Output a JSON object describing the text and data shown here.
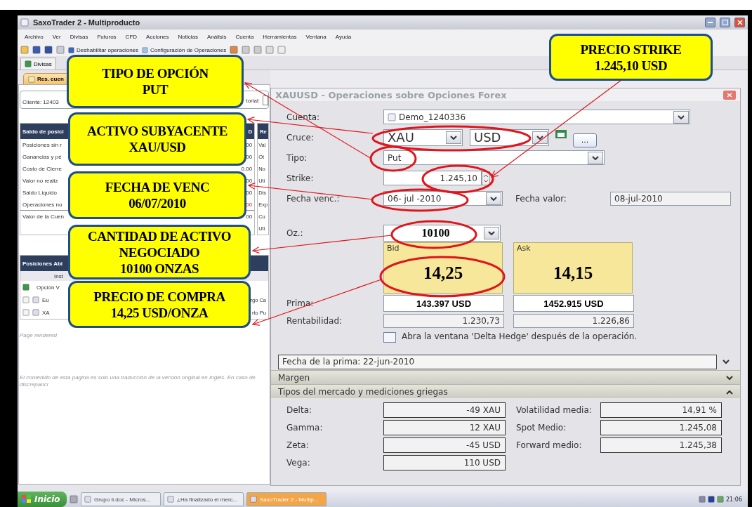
{
  "window": {
    "title": "SaxoTrader 2 - Multiproducto"
  },
  "menu": [
    "Archivo",
    "Ver",
    "Divisas",
    "Futuros",
    "CFD",
    "Acciones",
    "Noticias",
    "Análisis",
    "Cuenta",
    "Herramientas",
    "Ventana",
    "Ayuda"
  ],
  "toolbar": [
    "Deshabilitar operaciones",
    "Configuración de Operaciones"
  ],
  "tabs": [
    {
      "label": "Divisas",
      "selected": false
    }
  ],
  "subtab": {
    "label": "Res. cuen",
    "selected": true
  },
  "account_panel": {
    "client": "Cliente: 12403",
    "client_end": "torial:",
    "balance": {
      "title": "Saldo de posici",
      "title_end": "D",
      "rows": [
        {
          "label": "Posiciones sin r",
          "value": "00",
          "negative": false
        },
        {
          "label": "Ganancias y pé",
          "value": "00",
          "negative": false
        },
        {
          "label": "Costo de Cierre",
          "value": "0.00",
          "negative": false
        },
        {
          "label": "Valor no realiz",
          "value": "00",
          "negative": false
        },
        {
          "label": "Saldo Líquido",
          "value": "00",
          "negative": false
        },
        {
          "label": "Operaciones no",
          "value": "00",
          "negative": true
        },
        {
          "label": "Valor de la Cuen",
          "value": "00",
          "negative": false
        }
      ]
    },
    "side": {
      "title": "Re",
      "rows": [
        "Val",
        "Ot",
        "No",
        "Uti",
        "Dis",
        "Exp",
        "Cu",
        "Uti"
      ]
    },
    "positions": {
      "title": "Posiciones Abi",
      "column": "Inst",
      "group": "Opción V",
      "rows": [
        {
          "instrument": "Eu",
          "side": "rgo Ca"
        },
        {
          "instrument": "XA",
          "side": "rto Pu"
        }
      ]
    },
    "notes": [
      "Page rendered",
      "El contenido de esta página es solo una traducción de la versión original en Inglés. En caso de discrepanci"
    ]
  },
  "dialog": {
    "title": "XAUUSD - Operaciones sobre Opciones Forex",
    "cuenta": {
      "label": "Cuenta:",
      "value": "Demo_1240336"
    },
    "cruce": {
      "label": "Cruce:",
      "base": "XAU",
      "quote": "USD",
      "more": "..."
    },
    "tipo": {
      "label": "Tipo:",
      "value": "Put"
    },
    "strike": {
      "label": "Strike:",
      "value": "1.245,10"
    },
    "expiry": {
      "label": "Fecha venc.:",
      "value": "06- jul -2010"
    },
    "value_date": {
      "label": "Fecha valor:",
      "value": "08-jul-2010"
    },
    "amount": {
      "label": "Oz.:",
      "value": "10100"
    },
    "quotes": [
      {
        "label": "Bid",
        "price": "14,25"
      },
      {
        "label": "Ask",
        "price": "14,15"
      }
    ],
    "prima": {
      "label": "Prima:",
      "values": [
        "143.397 USD",
        "1452.915 USD"
      ]
    },
    "rentabilidad": {
      "label": "Rentabilidad:",
      "values": [
        "1.230,73",
        "1.226,86"
      ]
    },
    "delta_hedge": {
      "label": "Abra la ventana  'Delta Hedge' después de la operación.",
      "checked": false
    },
    "premium_date": {
      "text": "Fecha de la prima: 22-jun-2010",
      "expanded": false
    },
    "sections": [
      {
        "title": "Margen",
        "expanded": false
      },
      {
        "title": "Tipos del mercado y mediciones griegas",
        "expanded": true,
        "left": [
          {
            "label": "Delta:",
            "value": "-49 XAU"
          },
          {
            "label": "Gamma:",
            "value": "12 XAU"
          },
          {
            "label": "Zeta:",
            "value": "-45 USD"
          },
          {
            "label": "Vega:",
            "value": "110 USD"
          }
        ],
        "right": [
          {
            "label": "Volatilidad media:",
            "value": "14,91 %"
          },
          {
            "label": "Spot Medio:",
            "value": "1.245,08"
          },
          {
            "label": "Forward medio:",
            "value": "1.245,38"
          }
        ]
      }
    ]
  },
  "callouts": [
    {
      "text": "TIPO DE OPCIÓN\nPUT"
    },
    {
      "text": "ACTIVO SUBYACENTE\nXAU/USD"
    },
    {
      "text": "FECHA DE VENC\n06/07/2010"
    },
    {
      "text": "CANTIDAD DE ACTIVO\nNEGOCIADO\n10100 ONZAS"
    },
    {
      "text": "PRECIO DE COMPRA\n14,25 USD/ONZA"
    },
    {
      "text": "PRECIO STRIKE\n1.245,10 USD"
    }
  ],
  "taskbar": {
    "start": "Inicio",
    "items": [
      {
        "label": "Grupo ii.doc - Micros...",
        "selected": false
      },
      {
        "label": "¿Ha finalizado el merc...",
        "selected": false
      },
      {
        "label": "SaxoTrader 2 - Multip...",
        "selected": true
      }
    ],
    "clock": "21:06"
  }
}
